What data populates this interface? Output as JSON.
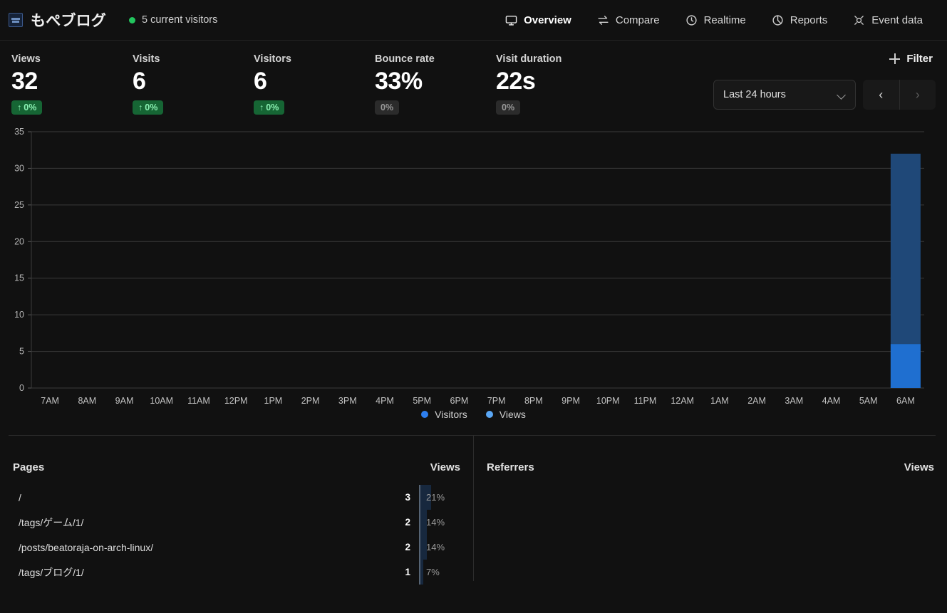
{
  "header": {
    "brand_name": "もぺブログ",
    "favicon_icon": "site-favicon",
    "live_visitors": "5 current visitors",
    "nav": [
      {
        "label": "Overview",
        "icon": "monitor-icon",
        "active": true
      },
      {
        "label": "Compare",
        "icon": "compare-arrows-icon",
        "active": false
      },
      {
        "label": "Realtime",
        "icon": "clock-icon",
        "active": false
      },
      {
        "label": "Reports",
        "icon": "pie-chart-icon",
        "active": false
      },
      {
        "label": "Event data",
        "icon": "target-icon",
        "active": false
      }
    ]
  },
  "metrics": [
    {
      "label": "Views",
      "value": "32",
      "change": "0%",
      "direction": "up",
      "arrow": "↑"
    },
    {
      "label": "Visits",
      "value": "6",
      "change": "0%",
      "direction": "up",
      "arrow": "↑"
    },
    {
      "label": "Visitors",
      "value": "6",
      "change": "0%",
      "direction": "up",
      "arrow": "↑"
    },
    {
      "label": "Bounce rate",
      "value": "33%",
      "change": "0%",
      "direction": "flat",
      "arrow": ""
    },
    {
      "label": "Visit duration",
      "value": "22s",
      "change": "0%",
      "direction": "flat",
      "arrow": ""
    }
  ],
  "controls": {
    "filter_label": "Filter",
    "filter_icon": "plus-icon",
    "date_range": "Last 24 hours",
    "date_chevron_icon": "chevron-down-icon",
    "prev_label": "‹",
    "next_label": "›"
  },
  "chart_data": {
    "type": "bar",
    "title": "",
    "xlabel": "",
    "ylabel": "",
    "ylim": [
      0,
      35
    ],
    "yticks": [
      0,
      5,
      10,
      15,
      20,
      25,
      30,
      35
    ],
    "grid": true,
    "legend_position": "bottom",
    "stacked": true,
    "categories": [
      "7AM",
      "8AM",
      "9AM",
      "10AM",
      "11AM",
      "12PM",
      "1PM",
      "2PM",
      "3PM",
      "4PM",
      "5PM",
      "6PM",
      "7PM",
      "8PM",
      "9PM",
      "10PM",
      "11PM",
      "12AM",
      "1AM",
      "2AM",
      "3AM",
      "4AM",
      "5AM",
      "6AM"
    ],
    "series": [
      {
        "name": "Visitors",
        "color": "#1f6fd0",
        "values": [
          0,
          0,
          0,
          0,
          0,
          0,
          0,
          0,
          0,
          0,
          0,
          0,
          0,
          0,
          0,
          0,
          0,
          0,
          0,
          0,
          0,
          0,
          0,
          6
        ]
      },
      {
        "name": "Views",
        "color": "#1f4878",
        "values": [
          0,
          0,
          0,
          0,
          0,
          0,
          0,
          0,
          0,
          0,
          0,
          0,
          0,
          0,
          0,
          0,
          0,
          0,
          0,
          0,
          0,
          0,
          0,
          32
        ]
      }
    ],
    "legend": [
      {
        "label": "Visitors",
        "color": "#2d7ff0"
      },
      {
        "label": "Views",
        "color": "#5aa7f5"
      }
    ]
  },
  "panels": {
    "pages": {
      "title": "Pages",
      "value_header": "Views",
      "rows": [
        {
          "name": "/",
          "value": "3",
          "percent": "21%",
          "percent_num": 21
        },
        {
          "name": "/tags/ゲーム/1/",
          "value": "2",
          "percent": "14%",
          "percent_num": 14
        },
        {
          "name": "/posts/beatoraja-on-arch-linux/",
          "value": "2",
          "percent": "14%",
          "percent_num": 14
        },
        {
          "name": "/tags/ブログ/1/",
          "value": "1",
          "percent": "7%",
          "percent_num": 7
        }
      ]
    },
    "referrers": {
      "title": "Referrers",
      "value_header": "Views",
      "rows": []
    }
  }
}
